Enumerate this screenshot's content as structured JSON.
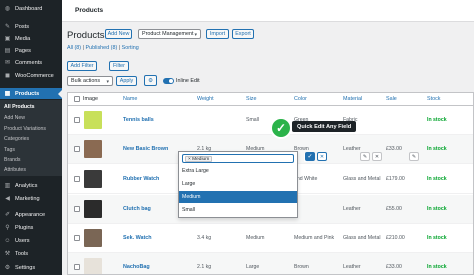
{
  "sidebar": {
    "items": [
      {
        "label": "Dashboard",
        "icon": "dashboard-icon",
        "glyph": "◍"
      },
      {
        "label": "Posts",
        "icon": "pin-icon",
        "glyph": "✎"
      },
      {
        "label": "Media",
        "icon": "media-icon",
        "glyph": "▣"
      },
      {
        "label": "Pages",
        "icon": "page-icon",
        "glyph": "▤"
      },
      {
        "label": "Comments",
        "icon": "comment-icon",
        "glyph": "✉"
      },
      {
        "label": "WooCommerce",
        "icon": "woo-icon",
        "glyph": "◼"
      },
      {
        "label": "Products",
        "icon": "products-icon",
        "glyph": "▦"
      }
    ],
    "submenu": [
      "All Products",
      "Add New",
      "Product Variations",
      "Categories",
      "Tags",
      "Brands",
      "Attributes"
    ],
    "bottom_items": [
      {
        "label": "Analytics",
        "icon": "analytics-icon",
        "glyph": "▥"
      },
      {
        "label": "Marketing",
        "icon": "megaphone-icon",
        "glyph": "◀"
      },
      {
        "label": "Appearance",
        "icon": "brush-icon",
        "glyph": "✐"
      },
      {
        "label": "Plugins",
        "icon": "plugin-icon",
        "glyph": "⚲"
      },
      {
        "label": "Users",
        "icon": "users-icon",
        "glyph": "☺"
      },
      {
        "label": "Tools",
        "icon": "tools-icon",
        "glyph": "⚒"
      },
      {
        "label": "Settings",
        "icon": "settings-icon",
        "glyph": "⚙"
      }
    ]
  },
  "topbar": {
    "title": "Products"
  },
  "header": {
    "title": "Products",
    "add_new": "Add New",
    "view_select": "Product Management",
    "import": "Import",
    "export": "Export"
  },
  "subsub": {
    "all": "All (8)",
    "sep1": " | ",
    "published": "Published (8)",
    "sep2": " | ",
    "sorting": "Sorting"
  },
  "filters": {
    "add_filter": "Add Filter",
    "filter": "Filter",
    "bulk_actions": "Bulk actions",
    "apply": "Apply",
    "inline_edit": "Inline Edit"
  },
  "table": {
    "columns": [
      "Image",
      "Name",
      "Weight",
      "Size",
      "Color",
      "Material",
      "Sale",
      "Stock"
    ],
    "rows": [
      {
        "name": "Tennis balls",
        "weight": "",
        "size": "Small",
        "color": "Green",
        "material": "Fabric",
        "sale": "",
        "stock": "In stock",
        "thumb": "#c8e05a"
      },
      {
        "name": "New Basic Brown",
        "weight": "2.1 kg",
        "size": "Medium",
        "color": "Brown",
        "material": "Leather",
        "sale": "£33.00",
        "stock": "In stock",
        "thumb": "#8a6a52"
      },
      {
        "name": "Rubber Watch",
        "weight": "",
        "size": "",
        "color": "and White",
        "material": "Glass and Metal",
        "sale": "£179.00",
        "stock": "In stock",
        "thumb": "#3a3a3a"
      },
      {
        "name": "Clutch bag",
        "weight": "",
        "size": "",
        "color": "",
        "material": "Leather",
        "sale": "£55.00",
        "stock": "In stock",
        "thumb": "#2b2b2b"
      },
      {
        "name": "Sek. Watch",
        "weight": "3.4 kg",
        "size": "Medium",
        "color": "Medium and Pink",
        "material": "Glass and Metal",
        "sale": "£210.00",
        "stock": "In stock",
        "thumb": "#7a6655"
      },
      {
        "name": "NachoBag",
        "weight": "2.1 kg",
        "size": "Large",
        "color": "Brown",
        "material": "Leather",
        "sale": "£33.00",
        "stock": "In stock",
        "thumb": "#e7e2da"
      }
    ]
  },
  "quick_edit": {
    "tag": "× Medium",
    "options": [
      "Extra Large",
      "Large",
      "Medium",
      "Small"
    ],
    "selected": "Medium",
    "callout": "Quick Edit Any Field",
    "check": "✓",
    "confirm": "✓",
    "cancel": "✕"
  }
}
